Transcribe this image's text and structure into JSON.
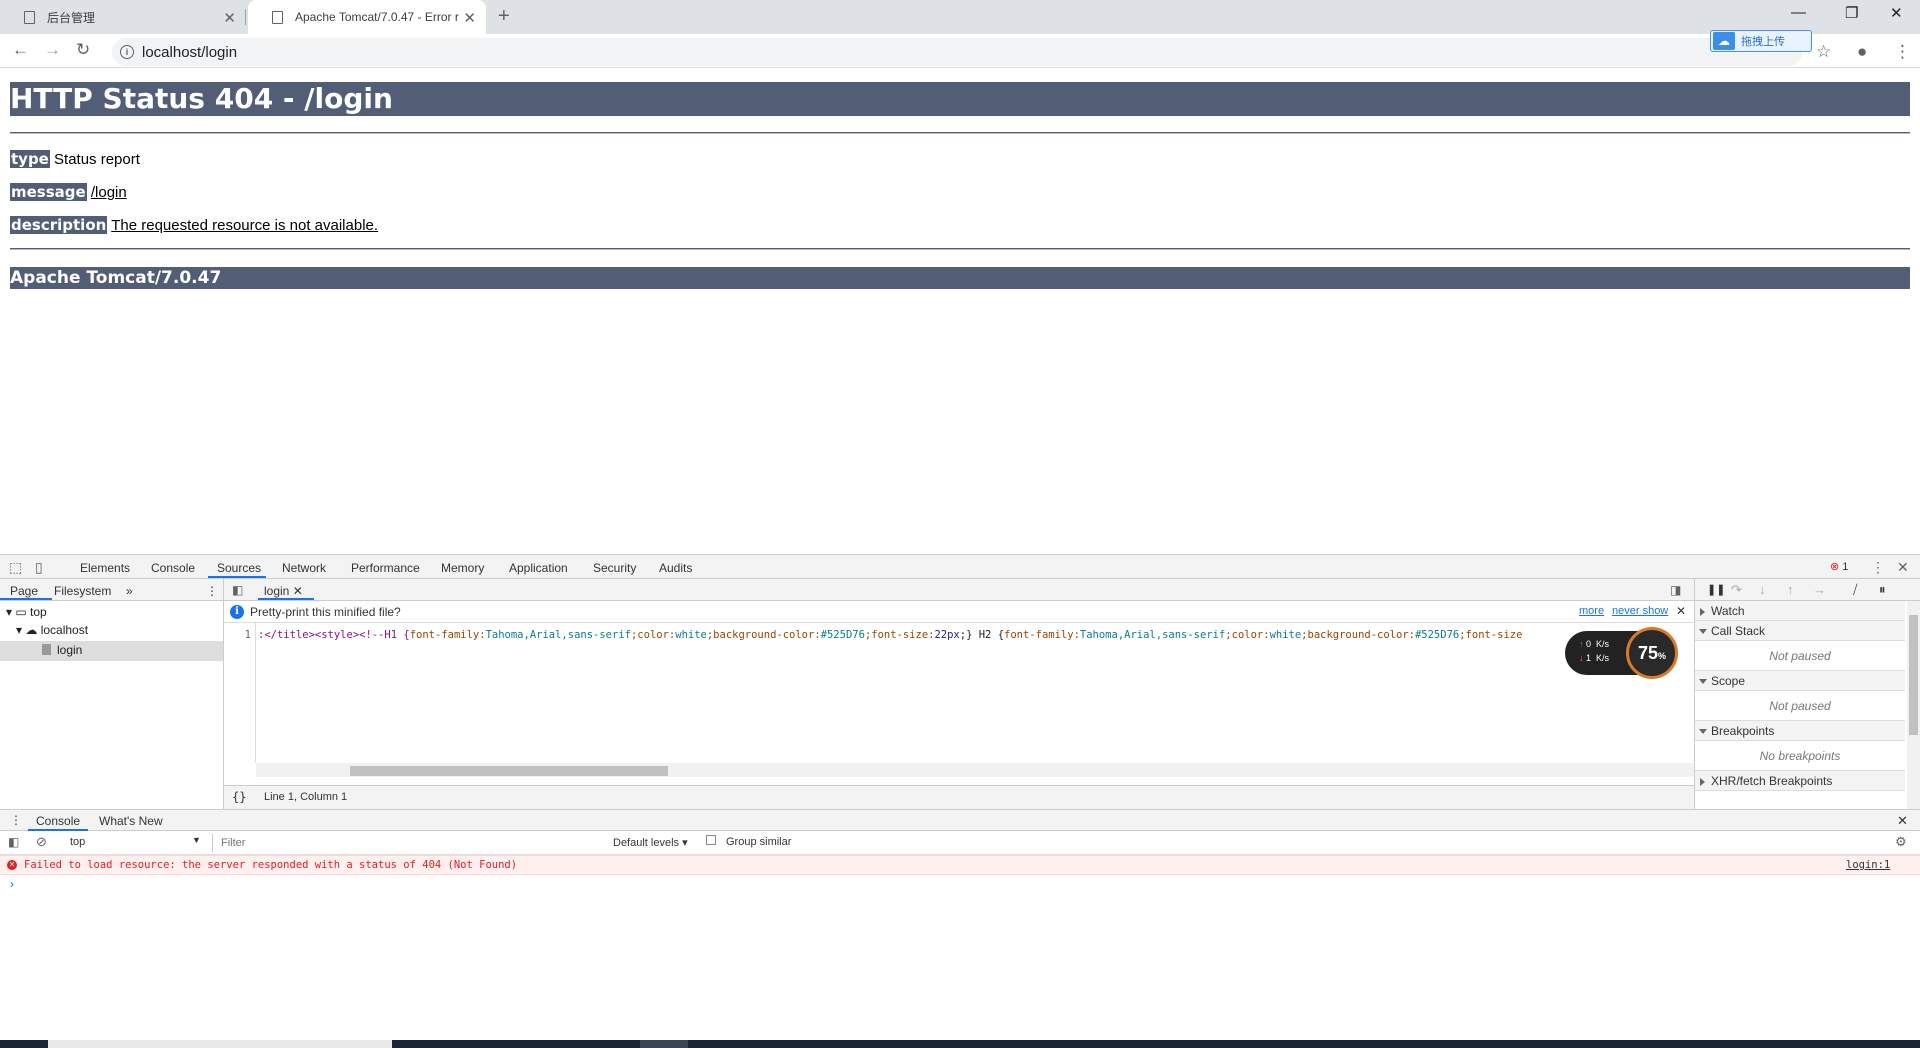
{
  "browser": {
    "tabs": [
      {
        "title": "后台管理",
        "active": false
      },
      {
        "title": "Apache Tomcat/7.0.47 - Error r",
        "active": true
      }
    ],
    "url": "localhost/login",
    "extension_label": "拖拽上传"
  },
  "page": {
    "heading": "HTTP Status 404 - /login",
    "rows": [
      {
        "label": "type",
        "value": "Status report"
      },
      {
        "label": "message",
        "value": "/login"
      },
      {
        "label": "description",
        "value": "The requested resource is not available."
      }
    ],
    "footer": "Apache Tomcat/7.0.47"
  },
  "devtools": {
    "tabs": [
      "Elements",
      "Console",
      "Sources",
      "Network",
      "Performance",
      "Memory",
      "Application",
      "Security",
      "Audits"
    ],
    "active_tab": "Sources",
    "error_count": "1",
    "navigator": {
      "tabs": [
        "Page",
        "Filesystem"
      ],
      "tree": [
        "top",
        "localhost",
        "login"
      ]
    },
    "editor": {
      "file_tab": "login",
      "pretty_print_prompt": "Pretty-print this minified file?",
      "pretty_more": "more",
      "pretty_never": "never show",
      "line_number": "1",
      "code": {
        "part1": ":</title><style><!--H1 {",
        "part2": "font-family:",
        "part3": "Tahoma,Arial,sans-serif",
        "part4": ";color:",
        "part5": "white",
        "part6": ";background-color:",
        "part7": "#525D76",
        "part8": ";font-size:",
        "part9": "22px",
        "part10": ";} H2 {",
        "part11": "font-family:",
        "part12": "Tahoma,Arial,sans-serif",
        "part13": ";color:",
        "part14": "white",
        "part15": ";background-color:",
        "part16": "#525D76",
        "part17": ";font-size"
      },
      "status": "Line 1, Column 1"
    },
    "debugger": {
      "sections": [
        {
          "title": "Watch",
          "open": false
        },
        {
          "title": "Call Stack",
          "open": true,
          "empty": "Not paused"
        },
        {
          "title": "Scope",
          "open": true,
          "empty": "Not paused"
        },
        {
          "title": "Breakpoints",
          "open": true,
          "empty": "No breakpoints"
        },
        {
          "title": "XHR/fetch Breakpoints",
          "open": false
        }
      ]
    },
    "net_monitor": {
      "up": "0",
      "down": "1",
      "unit": "K/s",
      "percent": "75"
    },
    "drawer": {
      "tabs": [
        "Console",
        "What's New"
      ],
      "context": "top",
      "filter_placeholder": "Filter",
      "levels": "Default levels",
      "group_similar": "Group similar",
      "error_message": "Failed to load resource: the server responded with a status of 404 (Not Found)",
      "error_source": "login:1"
    }
  }
}
